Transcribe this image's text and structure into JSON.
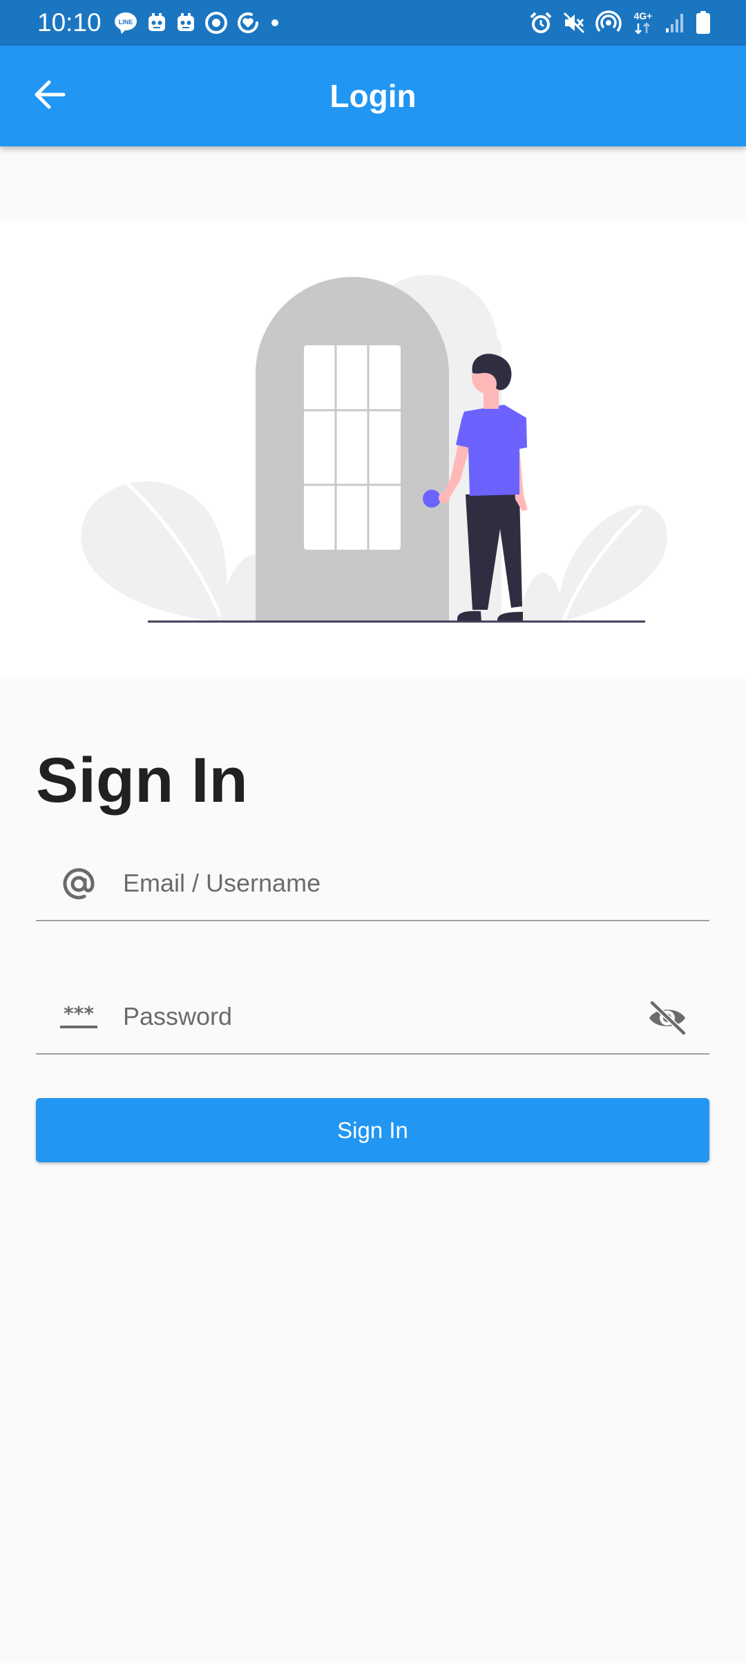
{
  "status_bar": {
    "time": "10:10",
    "network_label": "4G+",
    "left_icons": [
      "line-app-icon",
      "notification-icon",
      "notification-icon",
      "circle-app-icon",
      "heart-app-icon",
      "dot-icon"
    ],
    "right_icons": [
      "alarm-icon",
      "mute-icon",
      "hotspot-icon",
      "network-4g-icon",
      "signal-icon",
      "battery-icon"
    ]
  },
  "app_bar": {
    "title": "Login",
    "back_icon": "arrow-back-icon",
    "background": "#2196f3"
  },
  "login": {
    "heading": "Sign In",
    "email": {
      "placeholder": "Email / Username",
      "value": "",
      "icon": "at-sign-icon"
    },
    "password": {
      "placeholder": "Password",
      "value": "",
      "icon": "password-icon",
      "toggle_icon": "visibility-off-icon"
    },
    "submit_label": "Sign In"
  },
  "colors": {
    "primary": "#2196f3",
    "status_bar": "#1b76c2",
    "background": "#fafafa",
    "accent_figure": "#6c63ff"
  }
}
